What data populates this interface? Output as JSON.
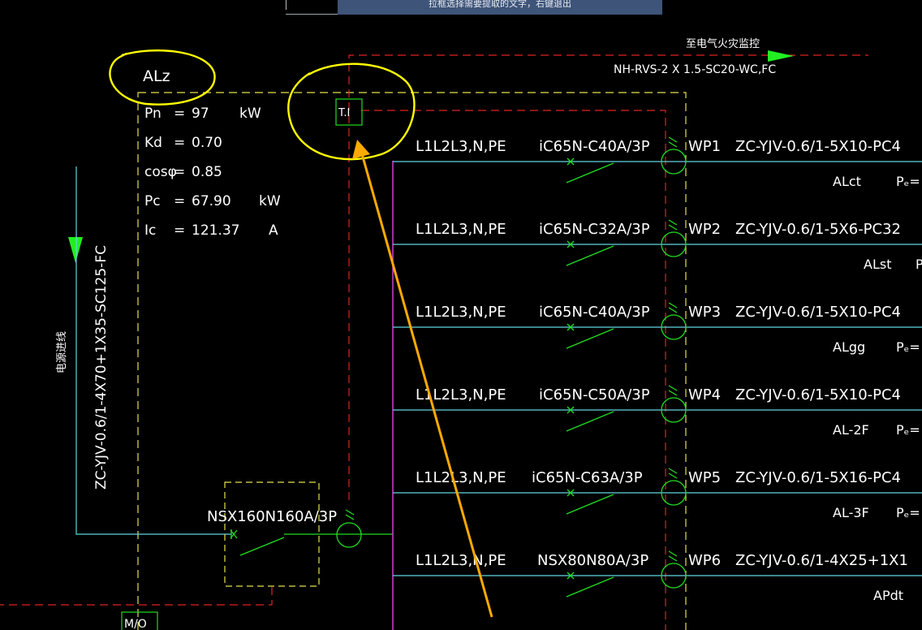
{
  "hint_bar": {
    "text": "拉框选择需要提取的文字，右键退出"
  },
  "fire_monitor": {
    "label": "至电气火灾监控",
    "cable": "NH-RVS-2 X 1.5-SC20-WC,FC"
  },
  "panel": {
    "name": "ALz",
    "params": [
      {
        "k": "Pn",
        "eq": "=",
        "v": "97",
        "u": "kW"
      },
      {
        "k": "Kd",
        "eq": "=",
        "v": "0.70",
        "u": ""
      },
      {
        "k": "cosφ",
        "eq": "=",
        "v": "0.85",
        "u": ""
      },
      {
        "k": "Pc",
        "eq": "=",
        "v": "67.90",
        "u": "kW"
      },
      {
        "k": "Ic",
        "eq": "=",
        "v": "121.37",
        "u": "A"
      }
    ],
    "ti_box": "T.I",
    "mo_box": "M/O"
  },
  "incoming": {
    "label": "电源进线",
    "cable": "ZC-YJV-0.6/1-4X70+1X35-SC125-FC",
    "breaker": "NSX160N160A/3P"
  },
  "circuits": [
    {
      "phases": "L1L2L3,N,PE",
      "breaker": "iC65N-C40A/3P",
      "id": "WP1",
      "cable": "ZC-YJV-0.6/1-5X10-PC4",
      "load": "ALct",
      "pe": "Pₑ="
    },
    {
      "phases": "L1L2L3,N,PE",
      "breaker": "iC65N-C32A/3P",
      "id": "WP2",
      "cable": "ZC-YJV-0.6/1-5X6-PC32",
      "load": "ALst",
      "pe": "P"
    },
    {
      "phases": "L1L2L3,N,PE",
      "breaker": "iC65N-C40A/3P",
      "id": "WP3",
      "cable": "ZC-YJV-0.6/1-5X10-PC4",
      "load": "ALgg",
      "pe": "Pₑ="
    },
    {
      "phases": "L1L2L3,N,PE",
      "breaker": "iC65N-C50A/3P",
      "id": "WP4",
      "cable": "ZC-YJV-0.6/1-5X10-PC4",
      "load": "AL-2F",
      "pe": "Pₑ="
    },
    {
      "phases": "L1L2L3,N,PE",
      "breaker": "iC65N-C63A/3P",
      "id": "WP5",
      "cable": "ZC-YJV-0.6/1-5X16-PC4",
      "load": "AL-3F",
      "pe": "Pₑ="
    },
    {
      "phases": "L1L2L3,N,PE",
      "breaker": "NSX80N80A/3P",
      "id": "WP6",
      "cable": "ZC-YJV-0.6/1-4X25+1X1",
      "load": "APdt",
      "pe": ""
    }
  ],
  "colors": {
    "background": "#000000",
    "text": "#ffffff",
    "wire_cyan": "#5fd6e0",
    "breaker_green": "#22dd22",
    "dash_yellow": "#e6e34a",
    "dash_red": "#e02222",
    "bus_magenta": "#d040d0",
    "annot_yellow": "#ffff00",
    "arrow_orange": "#ffaa00",
    "arrow_green": "#22ee22"
  }
}
